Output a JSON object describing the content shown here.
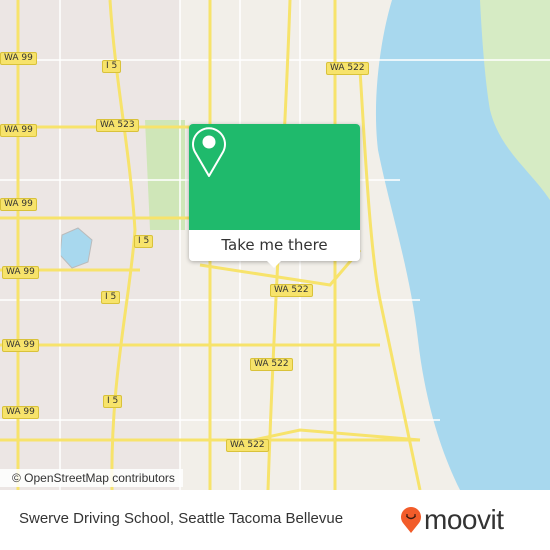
{
  "map": {
    "shields": [
      "I 5",
      "WA 99",
      "WA 522",
      "WA 99",
      "WA 523",
      "WA 99",
      "I 5",
      "WA 99",
      "WA 522",
      "I 5",
      "WA 99",
      "WA 522",
      "I 5",
      "WA 99",
      "WA 522"
    ],
    "attribution": "© OpenStreetMap contributors",
    "colors": {
      "land": "#f2efe9",
      "water": "#a8d8ee",
      "park": "#cfe6b8",
      "road": "#f7e36b"
    }
  },
  "popup": {
    "icon": "map-pin-icon",
    "button_label": "Take me there",
    "color": "#1fba6c"
  },
  "footer": {
    "title": "Swerve Driving School, Seattle Tacoma Bellevue",
    "logo_text": "moovit",
    "logo_color": "#f25c2a"
  }
}
